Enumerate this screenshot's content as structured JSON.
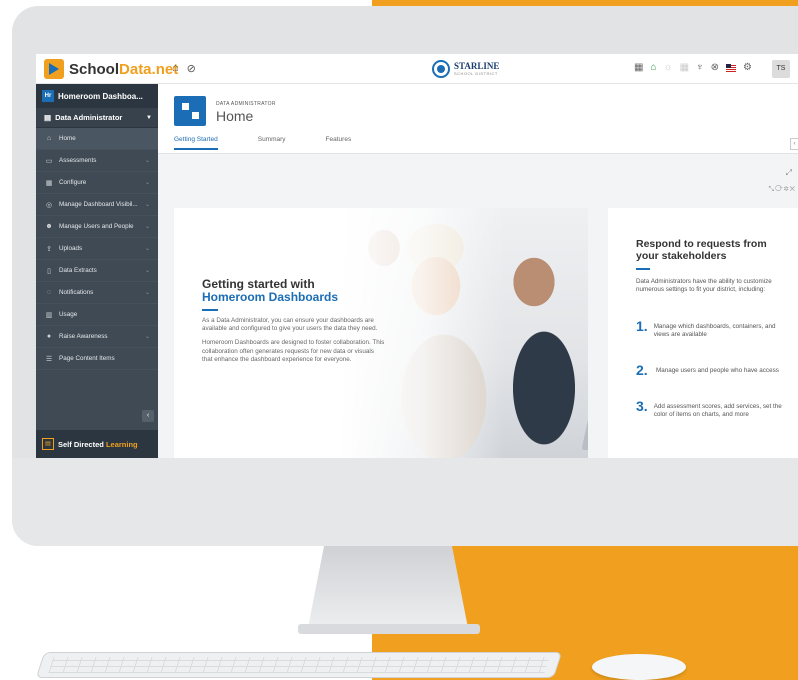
{
  "topbar": {
    "logo_primary": "School",
    "logo_accent": "Data.net",
    "home_icon": "home-icon",
    "help_icon": "compass-icon",
    "district_name": "STARLINE",
    "district_sub": "SCHOOL DISTRICT",
    "user_initials": "TS"
  },
  "sidebar": {
    "header_badge": "Hr",
    "header_title": "Homeroom Dashboa...",
    "role": "Data Administrator",
    "items": [
      {
        "label": "Home",
        "icon": "home-icon"
      },
      {
        "label": "Assessments",
        "icon": "assessment-icon"
      },
      {
        "label": "Configure",
        "icon": "table-icon"
      },
      {
        "label": "Manage Dashboard Visibil...",
        "icon": "eye-off-icon"
      },
      {
        "label": "Manage Users and People",
        "icon": "users-icon"
      },
      {
        "label": "Uploads",
        "icon": "upload-icon"
      },
      {
        "label": "Data Extracts",
        "icon": "file-icon"
      },
      {
        "label": "Notifications",
        "icon": "alert-icon"
      },
      {
        "label": "Usage",
        "icon": "chart-icon"
      },
      {
        "label": "Raise Awareness",
        "icon": "megaphone-icon"
      },
      {
        "label": "Page Content Items",
        "icon": "list-icon"
      }
    ],
    "footer_primary": "Self Directed",
    "footer_accent": "Learning"
  },
  "page": {
    "supertitle": "DATA ADMINISTRATOR",
    "title": "Home",
    "tabs": [
      "Getting Started",
      "Summary",
      "Features"
    ]
  },
  "hero": {
    "heading_line1": "Getting started with",
    "heading_line2": "Homeroom Dashboards",
    "para1": "As a Data Administrator, you can ensure your dashboards are available and configured to give your users the data they need.",
    "para2": "Homeroom Dashboards are designed to foster collaboration. This collaboration often generates requests for new data or visuals that enhance the dashboard experience for everyone."
  },
  "card": {
    "heading": "Respond to requests from your stakeholders",
    "intro": "Data Administrators have the ability to customize numerous settings to fit your district, including:",
    "items": [
      {
        "num": "1.",
        "text": "Manage which dashboards, containers, and views are available"
      },
      {
        "num": "2.",
        "text": "Manage users and people who have access"
      },
      {
        "num": "3.",
        "text": "Add assessment scores, add services, set the color of items on charts, and more"
      }
    ]
  },
  "colors": {
    "accent": "#f0a01e",
    "brand_blue": "#1b6db5",
    "sidebar": "#3f4a55"
  }
}
